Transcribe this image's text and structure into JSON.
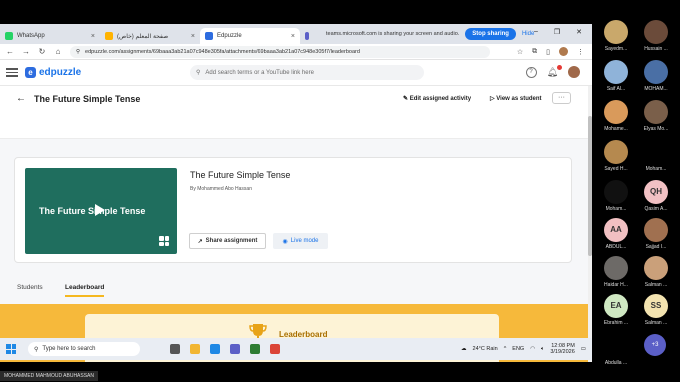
{
  "browser": {
    "tabs": [
      {
        "label": "WhatsApp",
        "color": "#25d366",
        "active": false
      },
      {
        "label": "صفحة المعلم (خاص)",
        "color": "#ffb300",
        "active": false
      },
      {
        "label": "Edpuzzle",
        "color": "#2d6cdf",
        "active": true
      },
      {
        "label": "",
        "color": "#5b5fc7",
        "active": false
      }
    ],
    "share_notice": "teams.microsoft.com is sharing your screen and audio.",
    "stop_sharing": "Stop sharing",
    "hide": "Hide",
    "url": "edpuzzle.com/assignments/69baaa3ab21a07c948e305fa/attachments/69baaa3ab21a07c948e305f7/leaderboard"
  },
  "header": {
    "logo": "edpuzzle",
    "search_placeholder": "Add search terms or a YouTube link here",
    "help_label": "?"
  },
  "assignment": {
    "back_icon": "←",
    "title": "The Future Simple Tense",
    "edit_activity": "Edit assigned activity",
    "view_as_student": "View as student",
    "more": "···"
  },
  "video": {
    "thumb_text": "The Future Simple Tense",
    "title": "The Future Simple Tense",
    "author": "By Mohammed Abo Hassan",
    "share_label": "Share assignment",
    "live_label": "Live mode",
    "thumb_color": "#1f6e5e"
  },
  "page_tabs": [
    {
      "label": "Students",
      "active": false
    },
    {
      "label": "Leaderboard",
      "active": true
    }
  ],
  "leaderboard": {
    "title": "Leaderboard",
    "accent": "#f6b93b"
  },
  "taskbar": {
    "search_placeholder": "Type here to search",
    "weather": "24°C  Rain",
    "lang": "ENG",
    "time": "12:08 PM",
    "date": "3/19/2026"
  },
  "presenter_name": "MOHAMMED MAHMOUD ABUHASSAN",
  "participants": [
    {
      "name": "Sayedm...",
      "initials": "",
      "color": "#c9a86b"
    },
    {
      "name": "Hussain ...",
      "initials": "",
      "color": "#6b4b3a"
    },
    {
      "name": "Saif Al...",
      "initials": "",
      "color": "#8fb3d9"
    },
    {
      "name": "MOHAM...",
      "initials": "",
      "color": "#4a6fa5"
    },
    {
      "name": "Mohame...",
      "initials": "",
      "color": "#d99a5b"
    },
    {
      "name": "Elyas Mo...",
      "initials": "",
      "color": "#7a5f4a"
    },
    {
      "name": "Sayed H...",
      "initials": "",
      "color": "#b5894f"
    },
    {
      "name": "Moham...",
      "initials": "",
      "color": "#000000"
    },
    {
      "name": "Moham...",
      "initials": "",
      "color": "#111111"
    },
    {
      "name": "Qasim A...",
      "initials": "QH",
      "color": "#f2c1c4"
    },
    {
      "name": "ABDUL...",
      "initials": "AA",
      "color": "#f1c0c2"
    },
    {
      "name": "Sajjad I...",
      "initials": "",
      "color": "#a07050"
    },
    {
      "name": "Haidar H...",
      "initials": "",
      "color": "#6d6a67"
    },
    {
      "name": "Salman ...",
      "initials": "",
      "color": "#caa07a"
    },
    {
      "name": "Ebrahim ...",
      "initials": "EA",
      "color": "#cfe8c2"
    },
    {
      "name": "Salman ...",
      "initials": "SS",
      "color": "#f3e3b0"
    },
    {
      "name": "Abdulla ...",
      "initials": "",
      "color": "#000000"
    }
  ],
  "more_participants": "+3"
}
